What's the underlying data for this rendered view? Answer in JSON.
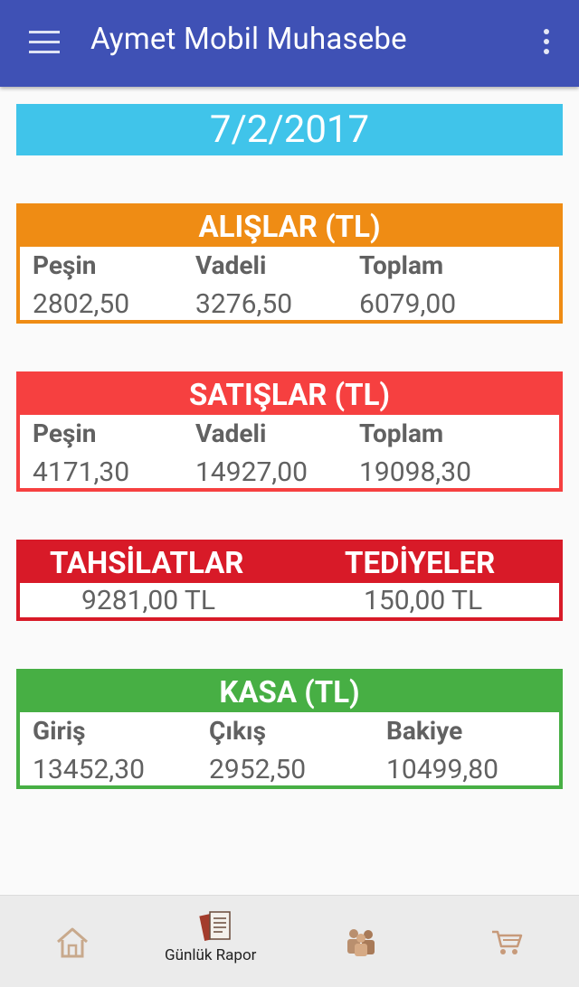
{
  "app": {
    "title": "Aymet Mobil Muhasebe"
  },
  "date": "7/2/2017",
  "alislar": {
    "title": "ALIŞLAR (TL)",
    "labels": [
      "Peşin",
      "Vadeli",
      "Toplam"
    ],
    "values": [
      "2802,50",
      "3276,50",
      "6079,00"
    ]
  },
  "satislar": {
    "title": "SATIŞLAR (TL)",
    "labels": [
      "Peşin",
      "Vadeli",
      "Toplam"
    ],
    "values": [
      "4171,30",
      "14927,00",
      "19098,30"
    ]
  },
  "tahsilat": {
    "left_title": "TAHSİLATLAR",
    "right_title": "TEDİYELER",
    "left_value": "9281,00 TL",
    "right_value": "150,00 TL"
  },
  "kasa": {
    "title": "KASA (TL)",
    "labels": [
      "Giriş",
      "Çıkış",
      "Bakiye"
    ],
    "values": [
      "13452,30",
      "2952,50",
      "10499,80"
    ]
  },
  "bottom_nav": {
    "items": [
      {
        "icon": "home-icon",
        "label": ""
      },
      {
        "icon": "report-icon",
        "label": "Günlük Rapor"
      },
      {
        "icon": "customers-icon",
        "label": ""
      },
      {
        "icon": "cart-icon",
        "label": ""
      }
    ]
  },
  "colors": {
    "appbar": "#3f51b5",
    "date": "#40c4ea",
    "alislar": "#ef8c14",
    "satislar": "#f64040",
    "tahsilat": "#d81a28",
    "kasa": "#47af44"
  }
}
